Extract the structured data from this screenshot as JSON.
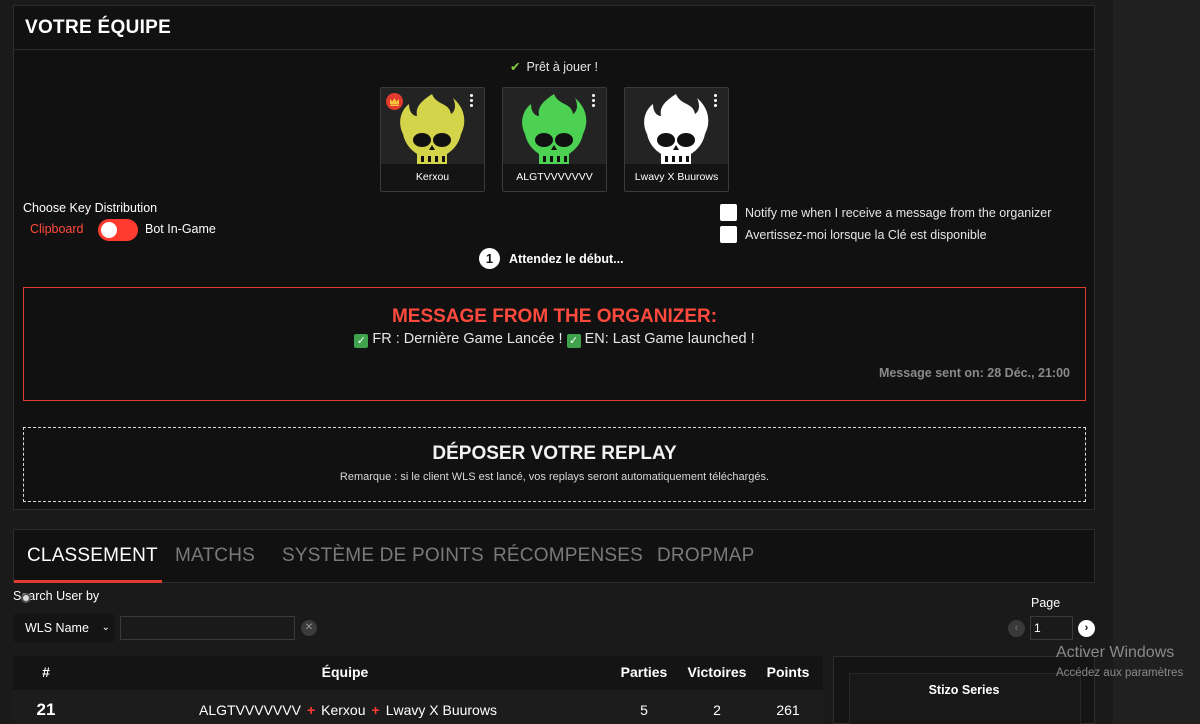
{
  "team": {
    "title": "VOTRE ÉQUIPE",
    "ready_text": "Prêt à jouer !",
    "players": [
      {
        "name": "Kerxou",
        "color": "#d4d44a",
        "is_leader": true
      },
      {
        "name": "ALGTVVVVVVV",
        "color": "#4cd152",
        "is_leader": false
      },
      {
        "name": "Lwavy X Buurows",
        "color": "#ffffff",
        "is_leader": false
      }
    ],
    "key_distribution": {
      "label": "Choose Key Distribution",
      "option_left": "Clipboard",
      "option_right": "Bot In-Game"
    },
    "notifications": [
      "Notify me when I receive a message from the organizer",
      "Avertissez-moi lorsque la Clé est disponible"
    ],
    "wait": {
      "step": "1",
      "text": "Attendez le début..."
    }
  },
  "organizer": {
    "title": "MESSAGE FROM THE ORGANIZER:",
    "message_fr": "FR : Dernière Game Lancée !",
    "message_en": "EN: Last Game launched !",
    "sent": "Message sent on: 28 Déc., 21:00"
  },
  "replay": {
    "title": "DÉPOSER VOTRE REPLAY",
    "note": "Remarque : si le client WLS est lancé, vos replays seront automatiquement téléchargés."
  },
  "tabs": [
    "CLASSEMENT",
    "MATCHS",
    "SYSTÈME DE POINTS",
    "RÉCOMPENSES",
    "DROPMAP"
  ],
  "search": {
    "label": "Search User by",
    "select_value": "WLS Name",
    "input_value": ""
  },
  "pagination": {
    "label": "Page",
    "value": "1"
  },
  "table": {
    "headers": {
      "rank": "#",
      "team": "Équipe",
      "games": "Parties",
      "wins": "Victoires",
      "points": "Points"
    },
    "rows": [
      {
        "rank": "21",
        "members": [
          "ALGTVVVVVVV",
          "Kerxou",
          "Lwavy X Buurows"
        ],
        "games": "5",
        "wins": "2",
        "points": "261"
      }
    ]
  },
  "side_card": {
    "title": "Stizo Series"
  },
  "watermark": {
    "line1": "Activer Windows",
    "line2": "Accédez aux paramètres"
  },
  "colors": {
    "accent": "#e03a2e",
    "ready": "#7fd13b",
    "check_green": "#3fa34d"
  }
}
